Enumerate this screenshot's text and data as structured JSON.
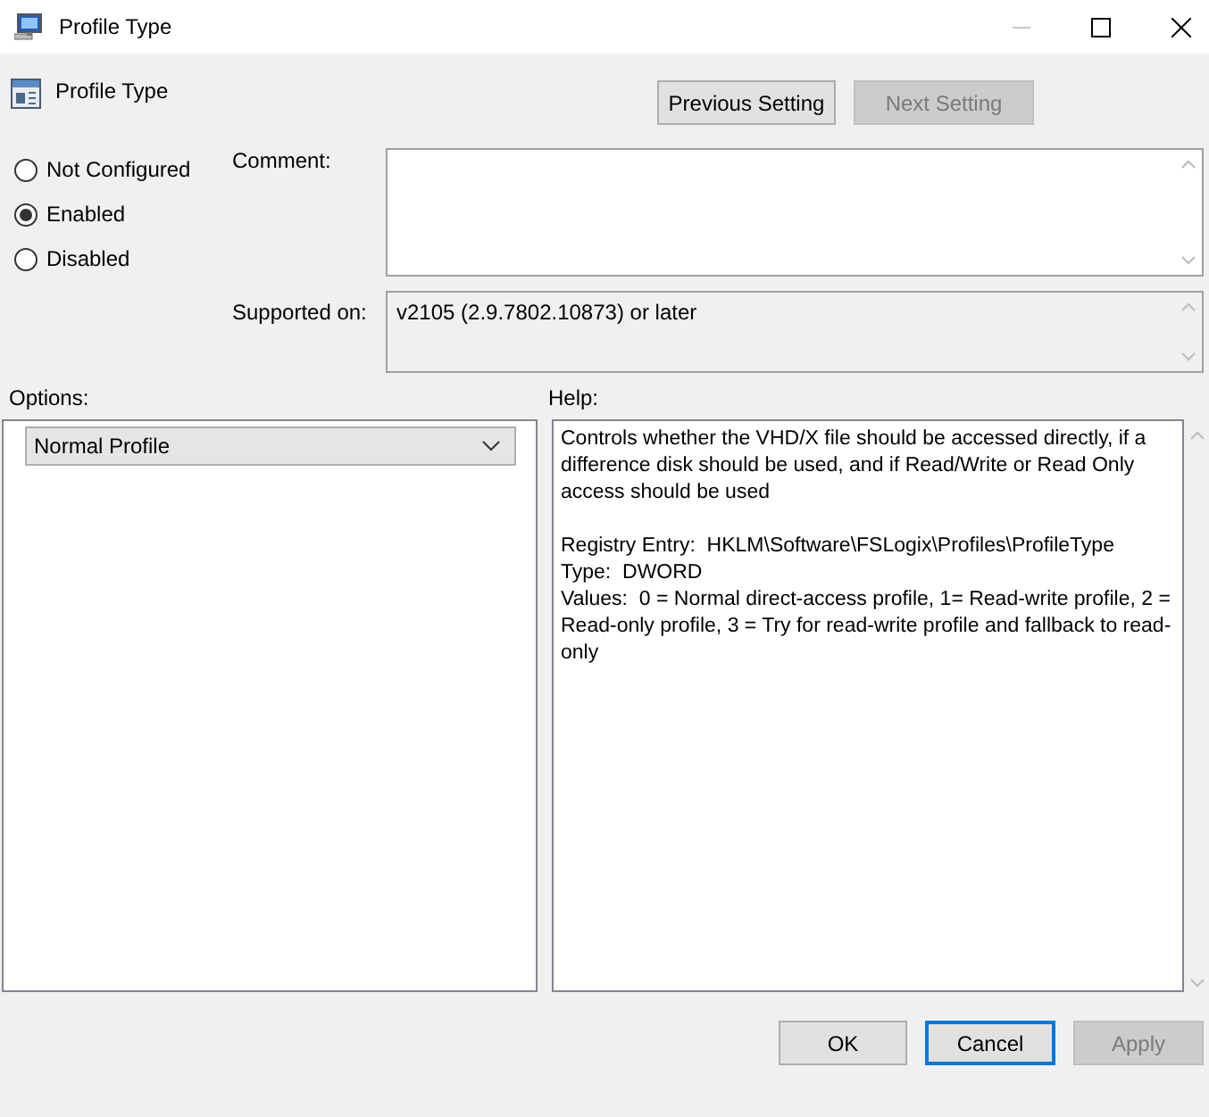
{
  "window": {
    "title": "Profile Type"
  },
  "header": {
    "title": "Profile Type"
  },
  "nav_buttons": [
    {
      "label": "Previous Setting",
      "disabled": false
    },
    {
      "label": "Next Setting",
      "disabled": true
    }
  ],
  "state_options": [
    {
      "label": "Not Configured",
      "selected": false
    },
    {
      "label": "Enabled",
      "selected": true
    },
    {
      "label": "Disabled",
      "selected": false
    }
  ],
  "comment": {
    "label": "Comment:"
  },
  "supported_on": {
    "label": "Supported on:",
    "value": "v2105 (2.9.7802.10873) or later"
  },
  "options": {
    "label": "Options:",
    "dropdown": {
      "value": "Normal Profile"
    }
  },
  "help": {
    "label": "Help:",
    "paragraphs": [
      "Controls whether the VHD/X file should be accessed directly, if a difference disk should be used, and if Read/Write or Read Only access should be used",
      "Registry Entry:  HKLM\\Software\\FSLogix\\Profiles\\ProfileType",
      "Type:  DWORD",
      "Values:  0 = Normal direct-access profile, 1= Read-write profile, 2 = Read-only profile, 3 = Try for read-write profile and fallback to read-only"
    ]
  },
  "buttons": [
    {
      "label": "OK",
      "disabled": false,
      "focused": false
    },
    {
      "label": "Cancel",
      "disabled": false,
      "focused": true
    },
    {
      "label": "Apply",
      "disabled": true,
      "focused": false
    }
  ]
}
